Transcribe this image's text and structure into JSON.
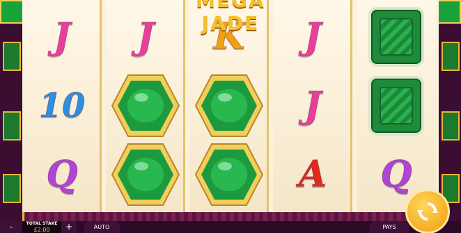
{
  "game": {
    "logo_text": "MEGA JADE"
  },
  "colors": {
    "frame_gold": "#e8b53a",
    "jade_green": "#1f8a3a",
    "reel_bg": "#fbf1dc",
    "bar_bg": "#2a0a24",
    "spin_orange": "#f29a10"
  },
  "reels": [
    {
      "symbols": [
        "J",
        "10",
        "Q"
      ]
    },
    {
      "symbols": [
        "J",
        "jade-hexagon",
        "jade-hexagon"
      ]
    },
    {
      "symbols": [
        "K",
        "jade-hexagon",
        "jade-hexagon"
      ]
    },
    {
      "symbols": [
        "J",
        "J",
        "A"
      ]
    },
    {
      "symbols": [
        "emerald",
        "emerald",
        "Q"
      ]
    }
  ],
  "controls": {
    "minus_label": "-",
    "stake_label": "TOTAL STAKE",
    "stake_value": "£2.00",
    "plus_label": "+",
    "auto_label": "AUTO",
    "pays_label": "PAYS"
  },
  "icons": {
    "spin": "spin-arrows-icon",
    "menu": "menu-icon"
  }
}
